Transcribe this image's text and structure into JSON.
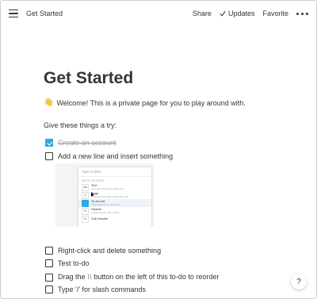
{
  "topbar": {
    "page_title": "Get Started",
    "share_label": "Share",
    "updates_label": "Updates",
    "favorite_label": "Favorite"
  },
  "page": {
    "title": "Get Started",
    "welcome_emoji": "👋",
    "welcome_text": "Welcome! This is a private page for you to play around with.",
    "try_heading": "Give these things a try:"
  },
  "todos": [
    {
      "label": "Create an account",
      "checked": true
    },
    {
      "label": "Add a new line and insert something",
      "checked": false
    },
    {
      "label": "Right-click and delete something",
      "checked": false
    },
    {
      "label": "Test to-do",
      "checked": false
    },
    {
      "label": "Drag the ⁝⁝ button on the left of this to-do to reorder",
      "checked": false
    },
    {
      "label": "Type '/' for slash commands",
      "checked": false
    }
  ],
  "slash_menu_image": {
    "filter_placeholder": "Type to filter",
    "section": "BASIC BLOCKS",
    "items": [
      {
        "name": "Text",
        "desc": "Just start writing with plain text."
      },
      {
        "name": "Page",
        "desc": "Embed a sub-page inside this page."
      },
      {
        "name": "To-do List",
        "desc": "Track tasks with a to-do list."
      },
      {
        "name": "Header",
        "desc": "A large header with margin."
      },
      {
        "name": "Sub Header",
        "desc": ""
      }
    ]
  },
  "help": {
    "label": "?"
  },
  "colors": {
    "checkbox_checked": "#2eaadc",
    "text": "#37352f",
    "muted": "#9b9a97"
  }
}
